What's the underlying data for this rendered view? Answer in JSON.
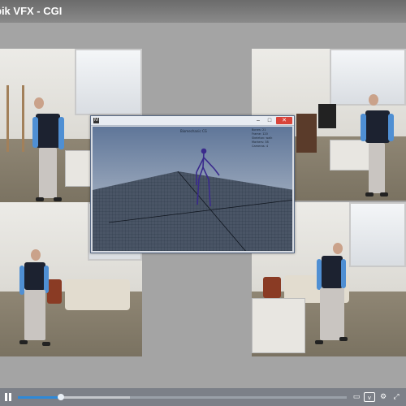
{
  "window": {
    "title": "bik VFX - CGI"
  },
  "cameras": [
    {
      "name": "camera-view-top-left"
    },
    {
      "name": "camera-view-top-right"
    },
    {
      "name": "camera-view-bottom-left"
    },
    {
      "name": "camera-view-bottom-right"
    }
  ],
  "maya_window": {
    "hud_title": "Biomechanic CG",
    "hud_lines": [
      "Bones: 21",
      "Frame: 120",
      "Skeleton: walk",
      "Markers: 38",
      "Cameras: 4"
    ],
    "close_label": "✕",
    "minimize_label": "–",
    "maximize_label": "□"
  },
  "player": {
    "progress_fraction": 0.13,
    "buffered_fraction": 0.34,
    "icons": {
      "pause": "pause-icon",
      "cc": "cc-icon",
      "vimeo": "vimeo-icon",
      "settings": "settings-icon",
      "fullscreen": "fullscreen-icon"
    },
    "cc_label": "▭",
    "vimeo_label": "v",
    "settings_label": "⚙",
    "fullscreen_label": "⤢"
  },
  "colors": {
    "accent": "#2e89d8",
    "shirt": "#1c2230",
    "sleeve": "#4f8fd3",
    "skeleton": "#3a2a8c"
  }
}
